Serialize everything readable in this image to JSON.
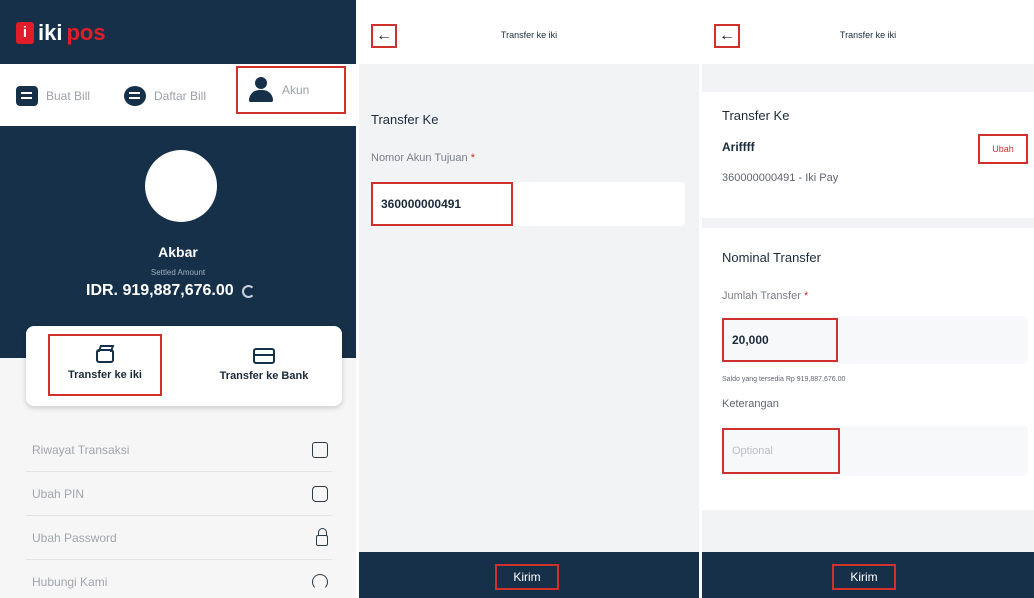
{
  "panel1": {
    "logo": {
      "mark": "i",
      "iki": "iki",
      "pos": "pos"
    },
    "nav": {
      "buat_bill": "Buat Bill",
      "daftar_bill": "Daftar Bill",
      "akun": "Akun"
    },
    "profile": {
      "name": "Akbar",
      "subtitle": "Settled Amount",
      "amount": "IDR. 919,887,676.00"
    },
    "transfer": {
      "iki": "Transfer ke iki",
      "bank": "Transfer ke Bank"
    },
    "menu": [
      {
        "label": "Riwayat Transaksi",
        "icon": "chart-icon"
      },
      {
        "label": "Ubah PIN",
        "icon": "pin-icon"
      },
      {
        "label": "Ubah Password",
        "icon": "lock-icon"
      },
      {
        "label": "Hubungi Kami",
        "icon": "support-icon"
      }
    ]
  },
  "panel2": {
    "title": "Transfer ke iki",
    "section_title": "Transfer Ke",
    "account_label": "Nomor Akun Tujuan",
    "account_value": "360000000491",
    "submit": "Kirim"
  },
  "panel3": {
    "title": "Transfer ke iki",
    "section_title": "Transfer Ke",
    "recipient_name": "Ariffff",
    "recipient_account": "360000000491 - Iki Pay",
    "change": "Ubah",
    "nominal_title": "Nominal Transfer",
    "amount_label": "Jumlah Transfer",
    "amount_value": "20,000",
    "balance_note": "Saldo yang tersedia Rp 919,887,676.00",
    "note_label": "Keterangan",
    "note_placeholder": "Optional",
    "submit": "Kirim"
  },
  "required_mark": "*",
  "back_arrow": "←",
  "colors": {
    "primary": "#163049",
    "accent": "#e11d2a",
    "highlight": "#d0312d"
  }
}
